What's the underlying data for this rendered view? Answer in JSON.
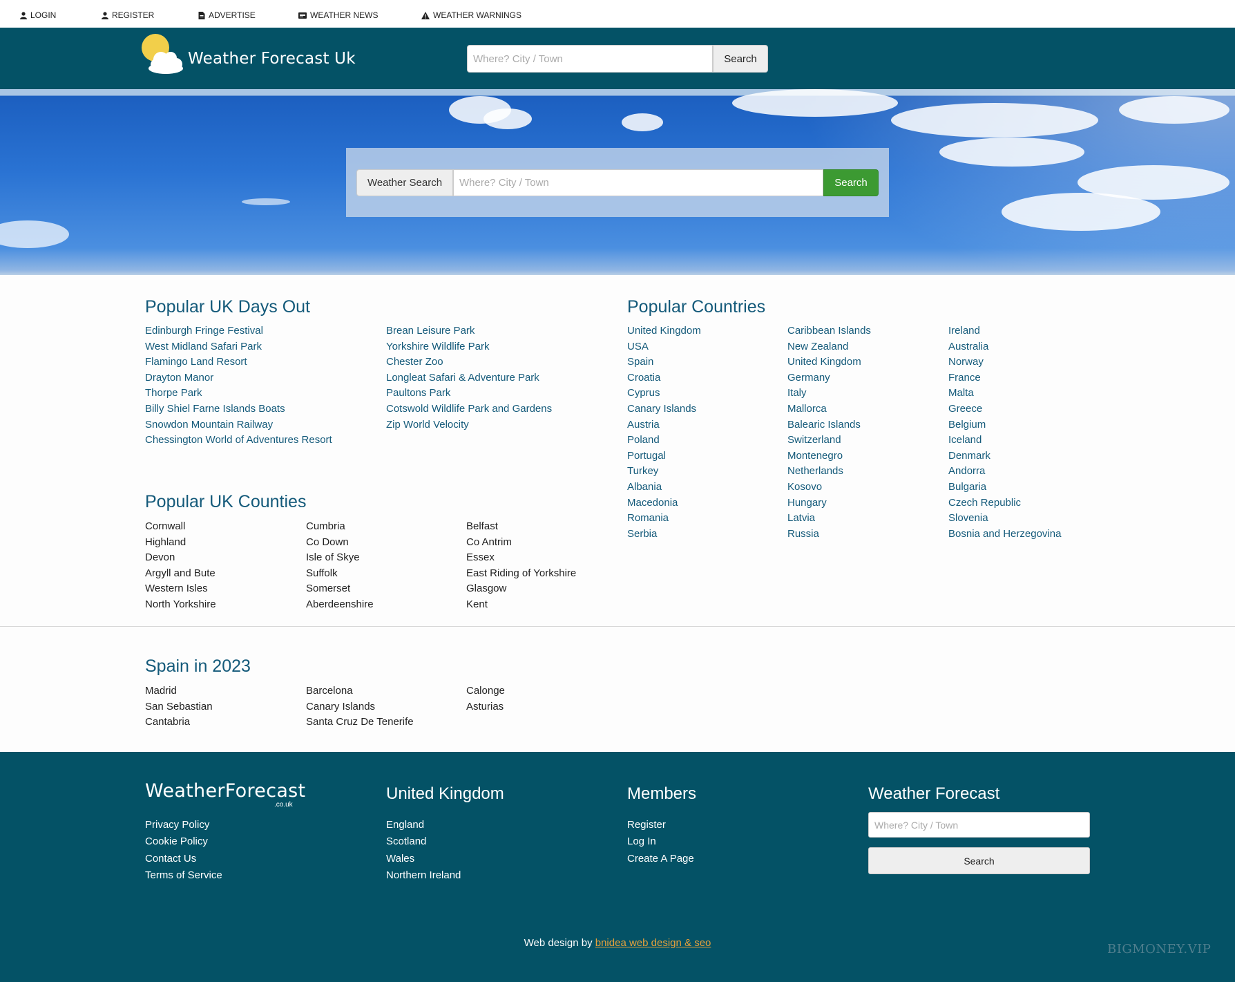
{
  "topnav": [
    {
      "label": "LOGIN",
      "icon": "user-icon"
    },
    {
      "label": "REGISTER",
      "icon": "user-icon"
    },
    {
      "label": "ADVERTISE",
      "icon": "document-icon"
    },
    {
      "label": "WEATHER NEWS",
      "icon": "newspaper-icon"
    },
    {
      "label": "WEATHER WARNINGS",
      "icon": "warning-icon"
    }
  ],
  "header": {
    "site_name": "Weather Forecast Uk",
    "search_placeholder": "Where? City / Town",
    "search_button": "Search"
  },
  "hero": {
    "label": "Weather Search",
    "search_placeholder": "Where? City / Town",
    "search_button": "Search"
  },
  "days_out": {
    "title": "Popular UK Days Out",
    "col1": [
      "Edinburgh Fringe Festival",
      "West Midland Safari Park",
      "Flamingo Land Resort",
      "Drayton Manor",
      "Thorpe Park",
      "Billy Shiel Farne Islands Boats",
      "Snowdon Mountain Railway",
      "Chessington World of Adventures Resort"
    ],
    "col2": [
      "Brean Leisure Park",
      "Yorkshire Wildlife Park",
      "Chester Zoo",
      "Longleat Safari & Adventure Park",
      "Paultons Park",
      "Cotswold Wildlife Park and Gardens",
      "Zip World Velocity"
    ]
  },
  "countries": {
    "title": "Popular Countries",
    "col1": [
      "United Kingdom",
      "USA",
      "Spain",
      "Croatia",
      "Cyprus",
      "Canary Islands",
      "Austria",
      "Poland",
      "Portugal",
      "Turkey",
      "Albania",
      "Macedonia",
      "Romania",
      "Serbia"
    ],
    "col2": [
      "Caribbean Islands",
      "New Zealand",
      "United Kingdom",
      "Germany",
      "Italy",
      "Mallorca",
      "Balearic Islands",
      "Switzerland",
      "Montenegro",
      "Netherlands",
      "Kosovo",
      "Hungary",
      "Latvia",
      "Russia"
    ],
    "col3": [
      "Ireland",
      "Australia",
      "Norway",
      "France",
      "Malta",
      "Greece",
      "Belgium",
      "Iceland",
      "Denmark",
      "Andorra",
      "Bulgaria",
      "Czech Republic",
      "Slovenia",
      "Bosnia and Herzegovina"
    ]
  },
  "counties": {
    "title": "Popular UK Counties",
    "col1": [
      "Cornwall",
      "Highland",
      "Devon",
      "Argyll and Bute",
      "Western Isles",
      "North Yorkshire"
    ],
    "col2": [
      "Cumbria",
      "Co Down",
      "Isle of Skye",
      "Suffolk",
      "Somerset",
      "Aberdeenshire"
    ],
    "col3": [
      "Belfast",
      "Co Antrim",
      "Essex",
      "East Riding of Yorkshire",
      "Glasgow",
      "Kent"
    ]
  },
  "spain": {
    "title": "Spain in 2023",
    "col1": [
      "Madrid",
      "San Sebastian",
      "Cantabria"
    ],
    "col2": [
      "Barcelona",
      "Canary Islands",
      "Santa Cruz De Tenerife"
    ],
    "col3": [
      "Calonge",
      "Asturias"
    ]
  },
  "footer": {
    "logo_text": "WeatherForecast",
    "logo_sub": ".co.uk",
    "links": [
      "Privacy Policy",
      "Cookie Policy",
      "Contact Us",
      "Terms of Service"
    ],
    "uk_title": "United Kingdom",
    "uk_links": [
      "England",
      "Scotland",
      "Wales",
      "Northern Ireland"
    ],
    "members_title": "Members",
    "members_links": [
      "Register",
      "Log In",
      "Create A Page"
    ],
    "wf_title": "Weather Forecast",
    "search_placeholder": "Where? City / Town",
    "search_button": "Search",
    "credit_prefix": "Web design by ",
    "credit_link": "bnidea web design & seo",
    "watermark": "BIGMONEY.VIP"
  },
  "colors": {
    "brand_teal": "#045266",
    "link_blue": "#145a7a",
    "search_green": "#3c9a32",
    "credit_orange": "#e8a13a"
  }
}
